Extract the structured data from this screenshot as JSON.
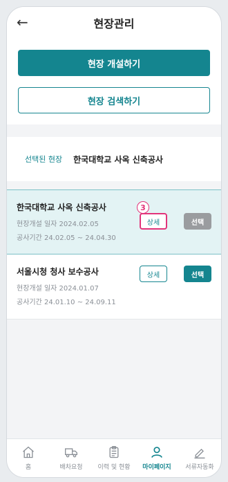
{
  "header": {
    "back_icon": "arrow-left-icon",
    "title": "현장관리"
  },
  "actions": {
    "open_site_label": "현장 개설하기",
    "search_site_label": "현장 검색하기"
  },
  "selected": {
    "label": "선택된 현장",
    "value": "한국대학교 사옥 신축공사"
  },
  "sites": [
    {
      "name": "한국대학교 사옥 신축공사",
      "opened": "현장개설 일자 2024.02.05",
      "period": "공사기간 24.02.05 ~ 24.04.30",
      "detail_label": "상세",
      "select_label": "선택",
      "state": "selected"
    },
    {
      "name": "서울시청 청사 보수공사",
      "opened": "현장개설 일자 2024.01.07",
      "period": "공사기간 24.01.10 ~ 24.09.11",
      "detail_label": "상세",
      "select_label": "선택",
      "state": "default"
    }
  ],
  "annotation": {
    "step": "3"
  },
  "nav": [
    {
      "label": "홈",
      "icon": "home-icon"
    },
    {
      "label": "배차요청",
      "icon": "truck-icon"
    },
    {
      "label": "이력 및 현황",
      "icon": "clipboard-icon"
    },
    {
      "label": "마이페이지",
      "icon": "user-icon",
      "active": true
    },
    {
      "label": "서류자동화",
      "icon": "pen-icon"
    }
  ],
  "colors": {
    "primary": "#14858f",
    "highlight": "#e2337a",
    "selected_bg": "#e3f3f4"
  }
}
